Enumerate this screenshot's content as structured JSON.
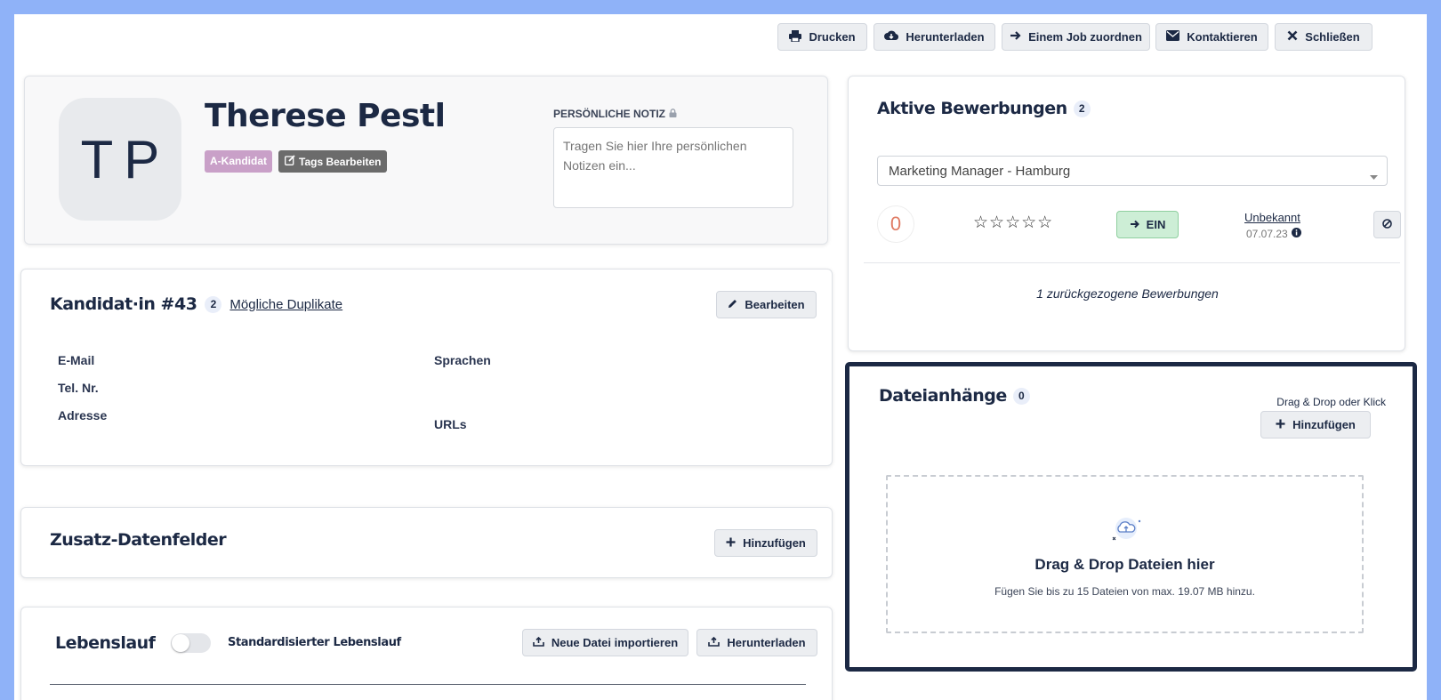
{
  "toolbar": {
    "print": "Drucken",
    "download": "Herunterladen",
    "assign_job": "Einem Job zuordnen",
    "contact": "Kontaktieren",
    "close": "Schließen"
  },
  "profile": {
    "initials": "TP",
    "name": "Therese Pestl",
    "tag": "A-Kandidat",
    "edit_tags": "Tags Bearbeiten",
    "note_label": "PERSÖNLICHE NOTIZ",
    "note_placeholder": "Tragen Sie hier Ihre persönlichen Notizen ein..."
  },
  "candidate": {
    "title": "Kandidat·in #43",
    "duplicate_count": "2",
    "duplicates_link": "Mögliche Duplikate",
    "edit": "Bearbeiten",
    "fields": {
      "email": "E-Mail",
      "phone": "Tel. Nr.",
      "address": "Adresse",
      "languages": "Sprachen",
      "urls": "URLs"
    }
  },
  "extra_fields": {
    "title": "Zusatz-Datenfelder",
    "add": "Hinzufügen"
  },
  "resume": {
    "title": "Lebenslauf",
    "toggle_label": "Standardisierter Lebenslauf",
    "toggle_on": false,
    "import": "Neue Datei importieren",
    "download": "Herunterladen"
  },
  "applications": {
    "title": "Aktive Bewerbungen",
    "count": "2",
    "selected_job": "Marketing Manager - Hamburg",
    "score": "0",
    "rating": 0,
    "stars": "☆☆☆☆☆",
    "stage_button": "EIN",
    "status": "Unbekannt",
    "date": "07.07.23",
    "withdrawn": "1 zurückgezogene Bewerbungen"
  },
  "attachments": {
    "title": "Dateianhänge",
    "count": "0",
    "hint": "Drag & Drop oder Klick",
    "add": "Hinzufügen",
    "drop_title": "Drag & Drop Dateien hier",
    "drop_sub": "Fügen Sie bis zu 15 Dateien von max. 19.07 MB hinzu."
  },
  "colors": {
    "background": "#8fb2f8",
    "navy": "#1c2944",
    "tag_purple": "#c9a0c8",
    "edit_tags_grey": "#6b6b6b",
    "score_red": "#e07b64",
    "stage_green": "#cdeed6"
  },
  "icons": [
    "print-icon",
    "cloud-download-icon",
    "arrow-right-icon",
    "envelope-icon",
    "close-icon",
    "lock-icon",
    "pencil-icon",
    "plus-icon",
    "upload-icon",
    "info-icon",
    "ban-icon",
    "cloud-upload-icon",
    "edit-square-icon",
    "caret-down-icon"
  ]
}
